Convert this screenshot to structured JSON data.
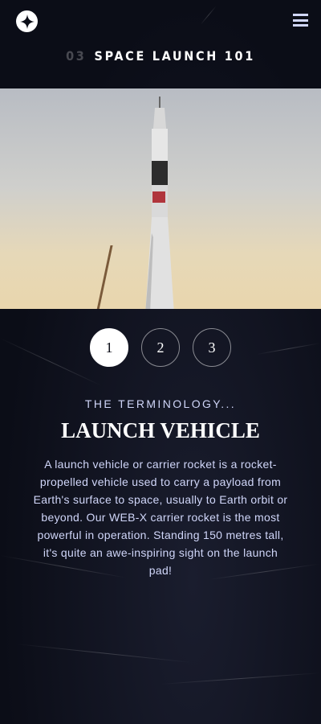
{
  "header": {
    "logo_icon": "star-logo-icon",
    "menu_icon": "hamburger-menu-icon"
  },
  "page": {
    "number": "03",
    "title": "SPACE LAUNCH 101"
  },
  "hero_image": {
    "subject": "rocket-launch-photo"
  },
  "slides": [
    {
      "label": "1",
      "active": true
    },
    {
      "label": "2",
      "active": false
    },
    {
      "label": "3",
      "active": false
    }
  ],
  "content": {
    "subtitle": "THE TERMINOLOGY...",
    "heading": "LAUNCH VEHICLE",
    "body": "A launch vehicle or carrier rocket is a rocket-propelled vehicle used to carry a payload from Earth's surface to space, usually to Earth orbit or beyond. Our WEB-X carrier rocket is the most powerful in operation. Standing 150 metres tall, it's quite an awe-inspiring sight on the launch pad!"
  },
  "colors": {
    "background": "#0b0d17",
    "accent": "#d0d6f9",
    "active": "#ffffff"
  }
}
